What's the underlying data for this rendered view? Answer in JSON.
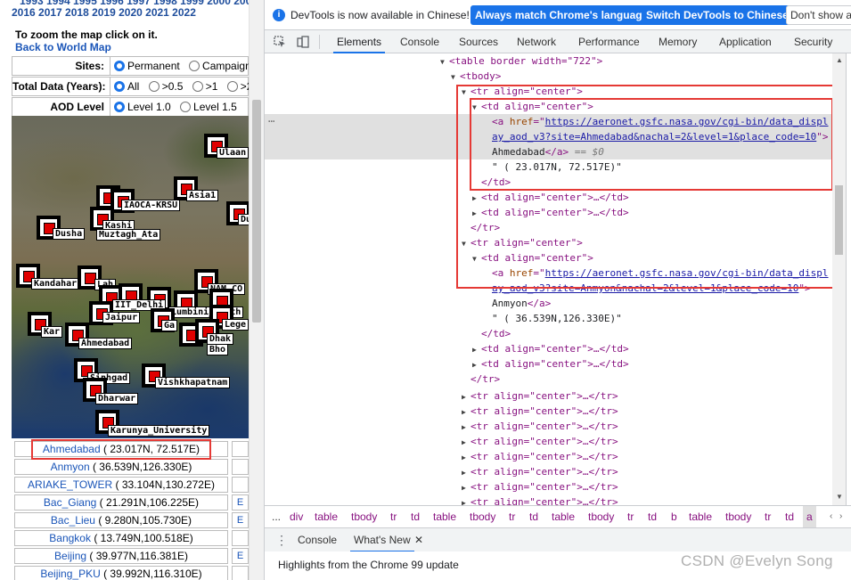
{
  "page": {
    "years_line_cut": "1993 1994 1995 1996 1997 1998 1999 2000 200",
    "years_line": "2016 2017 2018 2019 2020 2021 2022",
    "zoom_text": "To zoom the map click on it.",
    "back_link": "Back to World Map",
    "options": [
      {
        "label": "Sites:",
        "choices": [
          "Permanent",
          "Campaign"
        ],
        "selected": 0
      },
      {
        "label": "Total Data (Years):",
        "choices": [
          "All",
          ">0.5",
          ">1",
          ">2"
        ],
        "selected": 0
      },
      {
        "label": "AOD Level",
        "choices": [
          "Level 1.0",
          "Level 1.5"
        ],
        "selected": 0
      }
    ],
    "map_labels": {
      "ulaan": "Ulaan",
      "asia1": "Asia1",
      "iaoca": "IAOCA-KRSU",
      "du": "Du",
      "kashi": "Kashi",
      "dusha": "Dusha",
      "muztagh": "Muztagh_Ata",
      "kandahar": "Kandahar",
      "lah": "Lah",
      "nam": "NAM_CO",
      "iit": "IIT_Delhi",
      "lumbini": "Lumbini_North",
      "jaipur": "Jaipur",
      "ga": "Ga",
      "lege": "Lege",
      "kar": "Kar",
      "ahmedabad": "Ahmedabad",
      "dhak": "Dhak",
      "bho": "Bho",
      "sinhgad": "Sinhgad",
      "vishkhapatnam": "Vishkhapatnam",
      "dharwar": "Dharwar",
      "karunya": "Karunya_University"
    },
    "sites": [
      {
        "name": "Ahmedabad",
        "coord": "( 23.017N, 72.517E)"
      },
      {
        "name": "Anmyon",
        "coord": "( 36.539N,126.330E)"
      },
      {
        "name": "ARIAKE_TOWER",
        "coord": "( 33.104N,130.272E)"
      },
      {
        "name": "Bac_Giang",
        "coord": "( 21.291N,106.225E)"
      },
      {
        "name": "Bac_Lieu",
        "coord": "( 9.280N,105.730E)"
      },
      {
        "name": "Bangkok",
        "coord": "( 13.749N,100.518E)"
      },
      {
        "name": "Beijing",
        "coord": "( 39.977N,116.381E)"
      },
      {
        "name": "Beijing_PKU",
        "coord": "( 39.992N,116.310E)"
      }
    ],
    "side_letters": [
      "E",
      "E",
      "E"
    ]
  },
  "devtools": {
    "info_text": "DevTools is now available in Chinese!",
    "btn_match": "Always match Chrome's language",
    "btn_switch": "Switch DevTools to Chinese",
    "btn_dont": "Don't show a",
    "tabs": [
      "Elements",
      "Console",
      "Sources",
      "Network",
      "Performance",
      "Memory",
      "Application",
      "Security"
    ],
    "tree": {
      "table_open": "<table border width=\"722\">",
      "tbody": "<tbody>",
      "tr_open": "<tr align=\"center\">",
      "td_open": "<td align=\"center\">",
      "a_href_1a": "https://aeronet.gsfc.nasa.gov/cgi-bin/data_displ",
      "a_href_1b": "ay_aod_v3?site=Ahmedabad&nachal=2&level=1&place_code=10",
      "a_text_1": "Ahmedabad",
      "eq_dollar": "== $0",
      "coord_1": "\" ( 23.017N, 72.517E)\"",
      "td_close": "</td>",
      "td_collapsed": "<td align=\"center\">…</td>",
      "tr_close": "</tr>",
      "a_href_2a": "https://aeronet.gsfc.nasa.gov/cgi-bin/data_displ",
      "a_href_2b": "ay_aod_v3?site=Anmyon&nachal=2&level=1&place_code=10",
      "a_text_2": "Anmyon",
      "coord_2": "\" ( 36.539N,126.330E)\"",
      "tr_collapsed": "<tr align=\"center\">…</tr>"
    },
    "crumbs": [
      "...",
      "div",
      "table",
      "tbody",
      "tr",
      "td",
      "table",
      "tbody",
      "tr",
      "td",
      "table",
      "tbody",
      "tr",
      "td",
      "b",
      "table",
      "tbody",
      "tr",
      "td",
      "a"
    ],
    "drawer_tabs": [
      "Console",
      "What's New"
    ],
    "drawer_text": "Highlights from the Chrome 99 update"
  },
  "watermark": "CSDN @Evelyn Song",
  "colors": {
    "accent": "#1a73e8",
    "highlight": "#e53935",
    "tag": "#881280",
    "attr": "#994500",
    "value": "#1a1aa6"
  }
}
